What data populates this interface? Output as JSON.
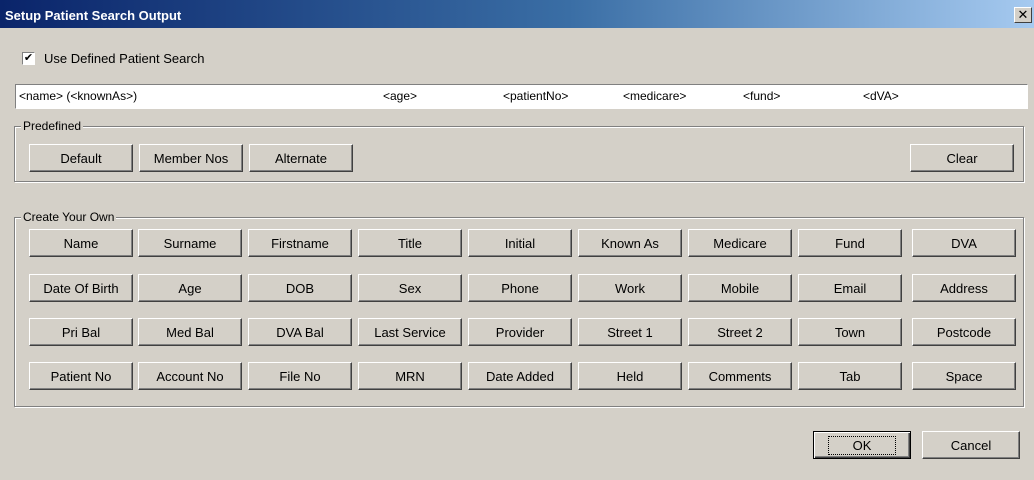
{
  "window": {
    "title": "Setup Patient Search Output",
    "close_glyph": "✕"
  },
  "use_defined": {
    "label": "Use Defined Patient Search",
    "checked": true,
    "check_glyph": "✔"
  },
  "pattern": {
    "tokens": [
      "<name> (<knownAs>)",
      "<age>",
      "<patientNo>",
      "<medicare>",
      "<fund>",
      "<dVA>"
    ]
  },
  "predefined": {
    "label": "Predefined",
    "buttons": [
      "Default",
      "Member Nos",
      "Alternate"
    ],
    "clear": "Clear"
  },
  "create_own": {
    "label": "Create Your Own",
    "rows": [
      [
        "Name",
        "Surname",
        "Firstname",
        "Title",
        "Initial",
        "Known As",
        "Medicare",
        "Fund",
        "DVA"
      ],
      [
        "Date Of Birth",
        "Age",
        "DOB",
        "Sex",
        "Phone",
        "Work",
        "Mobile",
        "Email",
        "Address"
      ],
      [
        "Pri Bal",
        "Med Bal",
        "DVA Bal",
        "Last Service",
        "Provider",
        "Street 1",
        "Street 2",
        "Town",
        "Postcode"
      ],
      [
        "Patient No",
        "Account No",
        "File No",
        "MRN",
        "Date Added",
        "Held",
        "Comments",
        "Tab",
        "Space"
      ]
    ]
  },
  "footer": {
    "ok": "OK",
    "cancel": "Cancel"
  }
}
